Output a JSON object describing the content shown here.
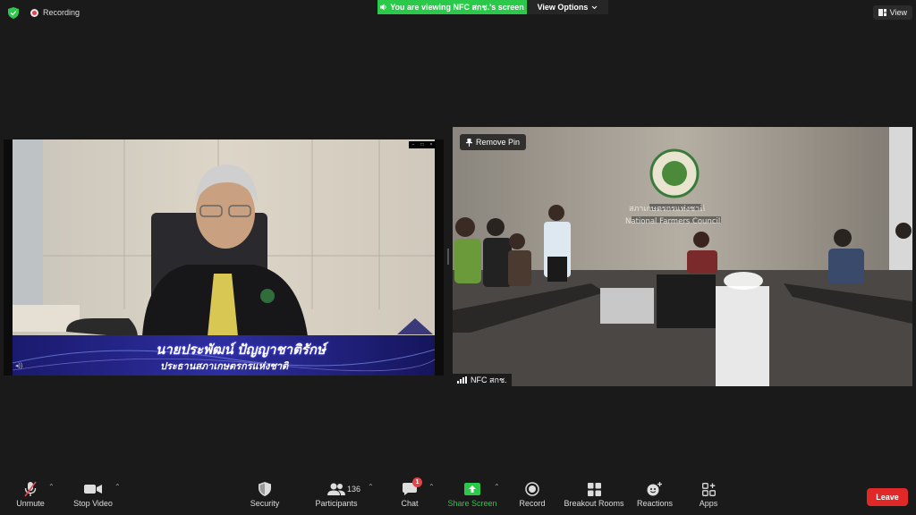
{
  "top": {
    "recording_label": "Recording",
    "banner_text": "You are viewing NFC สกช.'s screen",
    "view_options_label": "View Options",
    "view_label": "View"
  },
  "left_video": {
    "caption_name": "นายประพัฒน์ ปัญญาชาติรักษ์",
    "caption_title": "ประธานสภาเกษตรกรแห่งชาติ"
  },
  "right_video": {
    "remove_pin_label": "Remove Pin",
    "participant_name": "NFC สกช.",
    "sign_thai": "สภาเกษตรกรแห่งชาติ",
    "sign_english": "National Farmers Council"
  },
  "toolbar": {
    "unmute": "Unmute",
    "stop_video": "Stop Video",
    "security": "Security",
    "participants": "Participants",
    "participants_count": "136",
    "chat": "Chat",
    "chat_badge": "1",
    "share_screen": "Share Screen",
    "record": "Record",
    "breakout_rooms": "Breakout Rooms",
    "reactions": "Reactions",
    "apps": "Apps",
    "leave": "Leave"
  },
  "colors": {
    "banner": "#2ac94a",
    "leave": "#e02828",
    "share": "#2ac94a",
    "badge": "#e0454b"
  }
}
